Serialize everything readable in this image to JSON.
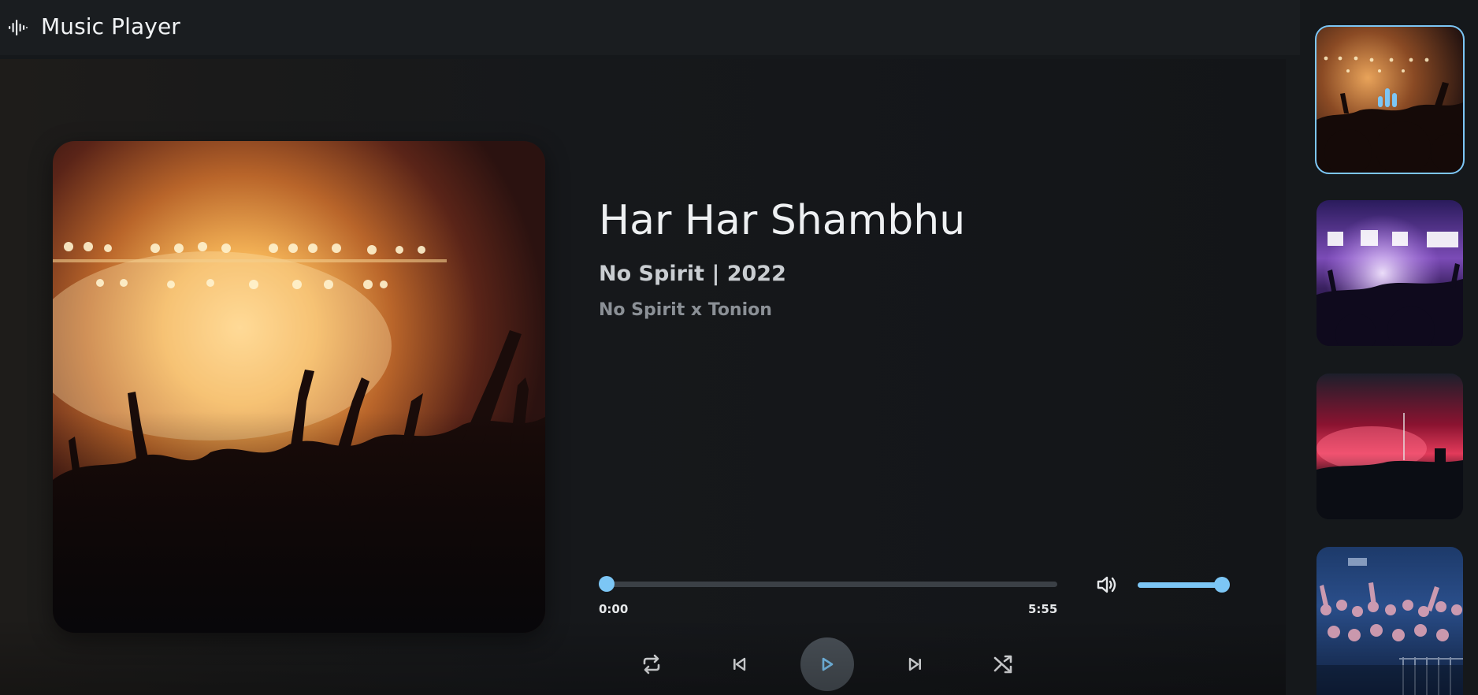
{
  "app": {
    "title": "Music Player",
    "icon": "waveform-icon"
  },
  "now_playing": {
    "title": "Har Har Shambhu",
    "subtitle": "No Spirit | 2022",
    "artists": "No Spirit x Tonion",
    "elapsed": "0:00",
    "duration": "5:55",
    "progress_fraction": 0,
    "volume_fraction": 0.92,
    "cover_icon": "concert-crowd-image"
  },
  "controls": {
    "repeat": "repeat-icon",
    "previous": "skip-previous-icon",
    "play": "play-icon",
    "next": "skip-next-icon",
    "shuffle": "shuffle-icon",
    "volume": "volume-icon"
  },
  "playlist": [
    {
      "thumbnail": "concert-orange-crowd",
      "active": true,
      "indicator": "equalizer-icon"
    },
    {
      "thumbnail": "concert-purple-lights",
      "active": false
    },
    {
      "thumbnail": "concert-red-smoke",
      "active": false
    },
    {
      "thumbnail": "concert-blue-crowd",
      "active": false
    }
  ],
  "colors": {
    "accent": "#7cc6f5",
    "background": "#15181b",
    "header": "#1a1d20",
    "play_button": "#495057"
  }
}
